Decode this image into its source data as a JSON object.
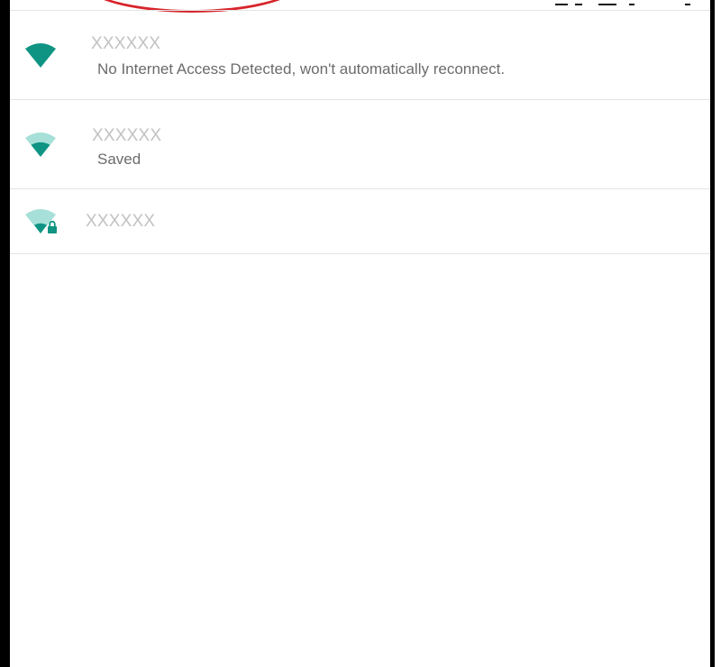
{
  "networks": [
    {
      "ssid": "XXXXXX",
      "status": "No Internet Access Detected, won't automatically reconnect.",
      "signal_icon": "wifi-signal-full-icon",
      "secured": false
    },
    {
      "ssid": "XXXXXX",
      "status": "Saved",
      "signal_icon": "wifi-signal-medium-icon",
      "secured": false
    },
    {
      "ssid": "XXXXXX",
      "status": "",
      "signal_icon": "wifi-signal-weak-locked-icon",
      "secured": true
    }
  ],
  "colors": {
    "accent": "#0f9483",
    "accent_light": "#a6e0d8",
    "ssid_text": "#c2c2c2",
    "status_text": "#6b6b6b",
    "annotation": "#d8232a"
  }
}
